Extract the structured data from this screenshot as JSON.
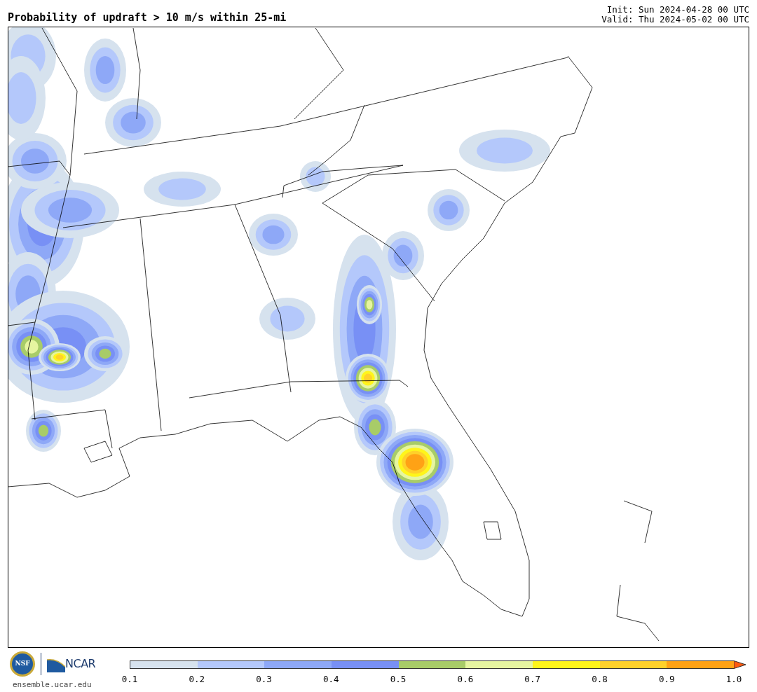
{
  "title": "Probability of updraft > 10 m/s within 25-mi",
  "init": "Init: Sun 2024-04-28 00 UTC",
  "valid": "Valid: Thu 2024-05-02 00 UTC",
  "logos": {
    "nsf": "NSF",
    "ncar": "NCAR",
    "site": "ensemble.ucar.edu"
  },
  "colorbar": {
    "bins": [
      {
        "color": "#d6e2ee"
      },
      {
        "color": "#b4c8fb"
      },
      {
        "color": "#8ea8f7"
      },
      {
        "color": "#7890f5"
      },
      {
        "color": "#a8cc68"
      },
      {
        "color": "#e6f5a0"
      },
      {
        "color": "#fff51a"
      },
      {
        "color": "#ffd12a"
      },
      {
        "color": "#ffa215"
      }
    ],
    "extend": {
      "color": "#ff5a10"
    },
    "ticks": [
      "0.1",
      "0.2",
      "0.3",
      "0.4",
      "0.5",
      "0.6",
      "0.7",
      "0.8",
      "0.9",
      "1.0"
    ]
  }
}
